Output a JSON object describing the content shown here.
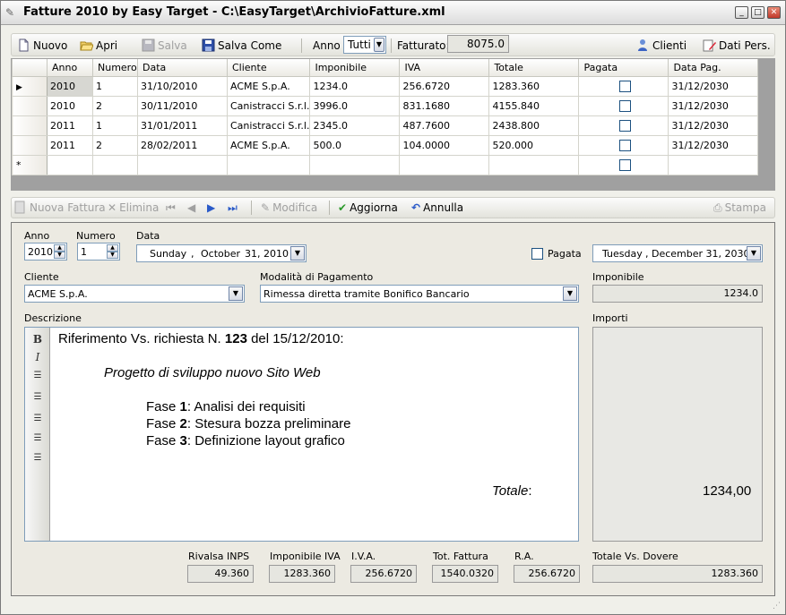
{
  "window": {
    "title": "Fatture 2010 by Easy Target - C:\\EasyTarget\\ArchivioFatture.xml",
    "buttons": {
      "minimize": "_",
      "maximize": "□",
      "close": "✕"
    }
  },
  "toolbar": {
    "nuovo": "Nuovo",
    "apri": "Apri",
    "salva": "Salva",
    "salva_come": "Salva Come",
    "anno_label": "Anno",
    "anno_value": "Tutti",
    "fatturato_label": "Fatturato:",
    "fatturato_value": "8075.0",
    "clienti": "Clienti",
    "dati_pers": "Dati Pers."
  },
  "grid": {
    "columns": [
      "Anno",
      "Numero",
      "Data",
      "Cliente",
      "Imponibile",
      "IVA",
      "Totale",
      "Pagata",
      "Data Pag."
    ],
    "rows": [
      {
        "anno": "2010",
        "numero": "1",
        "data": "31/10/2010",
        "cliente": "ACME S.p.A.",
        "imponibile": "1234.0",
        "iva": "256.6720",
        "totale": "1283.360",
        "pagata": false,
        "data_pag": "31/12/2030"
      },
      {
        "anno": "2010",
        "numero": "2",
        "data": "30/11/2010",
        "cliente": "Canistracci S.r.l.",
        "imponibile": "3996.0",
        "iva": "831.1680",
        "totale": "4155.840",
        "pagata": false,
        "data_pag": "31/12/2030"
      },
      {
        "anno": "2011",
        "numero": "1",
        "data": "31/01/2011",
        "cliente": "Canistracci S.r.l.",
        "imponibile": "2345.0",
        "iva": "487.7600",
        "totale": "2438.800",
        "pagata": false,
        "data_pag": "31/12/2030"
      },
      {
        "anno": "2011",
        "numero": "2",
        "data": "28/02/2011",
        "cliente": "ACME S.p.A.",
        "imponibile": "500.0",
        "iva": "104.0000",
        "totale": "520.000",
        "pagata": false,
        "data_pag": "31/12/2030"
      }
    ],
    "new_row_marker": "*"
  },
  "navbar": {
    "nuova_fattura": "Nuova Fattura",
    "elimina": "Elimina",
    "modifica": "Modifica",
    "aggiorna": "Aggiorna",
    "annulla": "Annulla",
    "stampa": "Stampa"
  },
  "form": {
    "anno_label": "Anno",
    "anno_value": "2010",
    "numero_label": "Numero",
    "numero_value": "1",
    "data_label": "Data",
    "data_day": "Sunday",
    "data_month": "October",
    "data_daynum": "31, 2010",
    "pagata_label": "Pagata",
    "data_pag_day": "Tuesday",
    "data_pag_rest": "December 31, 2030",
    "cliente_label": "Cliente",
    "cliente_value": "ACME S.p.A.",
    "modalita_label": "Modalità di Pagamento",
    "modalita_value": "Rimessa diretta tramite Bonifico Bancario",
    "imponibile_label": "Imponibile",
    "imponibile_value": "1234.0",
    "descrizione_label": "Descrizione",
    "importi_label": "Importi"
  },
  "editor": {
    "line1_a": "Riferimento Vs. richiesta N. ",
    "line1_b": "123",
    "line1_c": " del 15/12/2010:",
    "line2": "Progetto di sviluppo nuovo Sito Web",
    "fase_label": "Fase ",
    "fasi": [
      {
        "n": "1",
        "text": ": Analisi dei requisiti"
      },
      {
        "n": "2",
        "text": ": Stesura bozza preliminare"
      },
      {
        "n": "3",
        "text": ": Definizione layout grafico"
      }
    ],
    "totale_label": "Totale",
    "totale_colon": ":",
    "totale_value": "1234,00"
  },
  "totals": {
    "rivalsa_label": "Rivalsa INPS",
    "rivalsa_value": "49.360",
    "imponibile_iva_label": "Imponibile IVA",
    "imponibile_iva_value": "1283.360",
    "iva_label": "I.V.A.",
    "iva_value": "256.6720",
    "tot_fattura_label": "Tot. Fattura",
    "tot_fattura_value": "1540.0320",
    "ra_label": "R.A.",
    "ra_value": "256.6720",
    "totale_dovere_label": "Totale Vs. Dovere",
    "totale_dovere_value": "1283.360"
  }
}
